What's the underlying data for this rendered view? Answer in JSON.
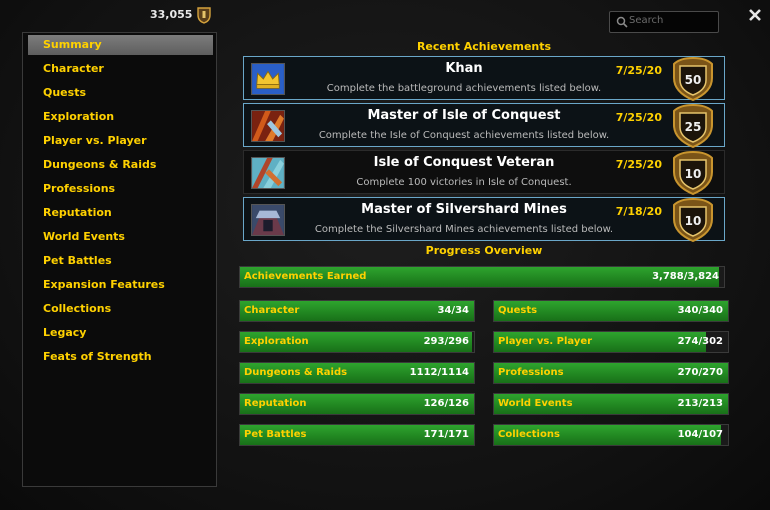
{
  "header": {
    "points": "33,055"
  },
  "search": {
    "placeholder": "Search"
  },
  "sidebar": {
    "items": [
      {
        "label": "Summary"
      },
      {
        "label": "Character"
      },
      {
        "label": "Quests"
      },
      {
        "label": "Exploration"
      },
      {
        "label": "Player vs. Player"
      },
      {
        "label": "Dungeons & Raids"
      },
      {
        "label": "Professions"
      },
      {
        "label": "Reputation"
      },
      {
        "label": "World Events"
      },
      {
        "label": "Pet Battles"
      },
      {
        "label": "Expansion Features"
      },
      {
        "label": "Collections"
      },
      {
        "label": "Legacy"
      },
      {
        "label": "Feats of Strength"
      }
    ],
    "selected": "Summary"
  },
  "recent": {
    "title": "Recent Achievements",
    "items": [
      {
        "title": "Khan",
        "desc": "Complete the battleground achievements listed below.",
        "date": "7/25/20",
        "points": "50",
        "icon": "crown-icon"
      },
      {
        "title": "Master of Isle of Conquest",
        "desc": "Complete the Isle of Conquest achievements listed below.",
        "date": "7/25/20",
        "points": "25",
        "icon": "isle-icon"
      },
      {
        "title": "Isle of Conquest Veteran",
        "desc": "Complete 100 victories in Isle of Conquest.",
        "date": "7/25/20",
        "points": "10",
        "icon": "isle-veteran-icon"
      },
      {
        "title": "Master of Silvershard Mines",
        "desc": "Complete the Silvershard Mines achievements listed below.",
        "date": "7/18/20",
        "points": "10",
        "icon": "mine-icon"
      }
    ]
  },
  "progress": {
    "title": "Progress Overview",
    "total": {
      "label": "Achievements Earned",
      "value": "3,788/3,824",
      "fraction": 0.9906
    },
    "categories": [
      {
        "label": "Character",
        "value": "34/34",
        "fraction": 1.0
      },
      {
        "label": "Quests",
        "value": "340/340",
        "fraction": 1.0
      },
      {
        "label": "Exploration",
        "value": "293/296",
        "fraction": 0.9899
      },
      {
        "label": "Player vs. Player",
        "value": "274/302",
        "fraction": 0.9073
      },
      {
        "label": "Dungeons & Raids",
        "value": "1112/1114",
        "fraction": 0.9982
      },
      {
        "label": "Professions",
        "value": "270/270",
        "fraction": 1.0
      },
      {
        "label": "Reputation",
        "value": "126/126",
        "fraction": 1.0
      },
      {
        "label": "World Events",
        "value": "213/213",
        "fraction": 1.0
      },
      {
        "label": "Pet Battles",
        "value": "171/171",
        "fraction": 1.0
      },
      {
        "label": "Collections",
        "value": "104/107",
        "fraction": 0.972
      }
    ]
  },
  "colors": {
    "accent": "#ffd100",
    "bar_fill": "#2ea42e",
    "highlight_border": "#6aa7c9"
  }
}
